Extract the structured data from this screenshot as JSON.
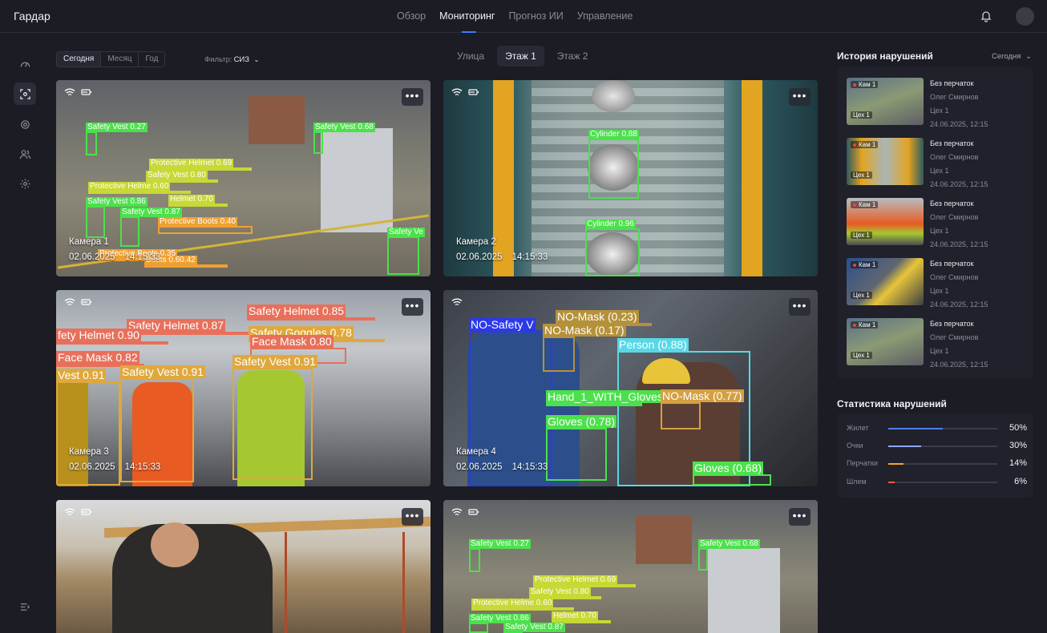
{
  "header": {
    "brand": "Гардар",
    "nav": [
      "Обзор",
      "Мониторинг",
      "Прогноз ИИ",
      "Управление"
    ],
    "active_nav": "Мониторинг"
  },
  "filters": {
    "periods": [
      "Сегодня",
      "Месяц",
      "Год"
    ],
    "active_period": "Сегодня",
    "filter_label": "Фильтр:",
    "filter_value": "СИЗ"
  },
  "floor_tabs": [
    "Улица",
    "Этаж 1",
    "Этаж 2"
  ],
  "active_floor": "Этаж 1",
  "cameras": [
    {
      "name": "Камера 1",
      "date": "02.06.2025",
      "time": "14:15:33",
      "detections": [
        {
          "label": "Safety Vest 0.27"
        },
        {
          "label": "Safety Vest 0.68"
        },
        {
          "label": "Protective Helmet 0.69"
        },
        {
          "label": "Safety Vest 0.80"
        },
        {
          "label": "Protective Helme 0.60"
        },
        {
          "label": "Safety Vest 0.86"
        },
        {
          "label": "Helmet 0.70"
        },
        {
          "label": "Safety Vest 0.87"
        },
        {
          "label": "Protective Boots 0.40"
        },
        {
          "label": "Protective Boots 0.35"
        },
        {
          "label": "Boots 0.60.42"
        },
        {
          "label": "Safety Ve"
        }
      ]
    },
    {
      "name": "Камера 2",
      "date": "02.06.2025",
      "time": "14:15:33",
      "detections": [
        {
          "label": "Cylinder 0.88"
        },
        {
          "label": "Cylinder 0.96"
        }
      ]
    },
    {
      "name": "Камера 3",
      "date": "02.06.2025",
      "time": "14:15:33",
      "detections": [
        {
          "label": "Safety Helmet 0.85"
        },
        {
          "label": "Safety Helmet 0.87"
        },
        {
          "label": "fety Helmet 0.90"
        },
        {
          "label": "Safety Goggles 0.78"
        },
        {
          "label": "Face Mask 0.80"
        },
        {
          "label": "Face Mask 0.82"
        },
        {
          "label": "Safety Vest 0.91"
        },
        {
          "label": "Vest 0.91"
        },
        {
          "label": "Safety Vest 0.91"
        }
      ]
    },
    {
      "name": "Камера 4",
      "date": "02.06.2025",
      "time": "14:15:33",
      "detections": [
        {
          "label": "NO-Safety V"
        },
        {
          "label": "NO-Mask (0.23)"
        },
        {
          "label": "NO-Mask (0.17)"
        },
        {
          "label": "Person (0.88)"
        },
        {
          "label": "Hand_1_WITH_Gloves"
        },
        {
          "label": "NO-Mask (0.77)"
        },
        {
          "label": "Gloves (0.78)"
        },
        {
          "label": "Gloves (0.68)"
        }
      ]
    },
    {
      "name": "",
      "date": "",
      "time": "",
      "detections": []
    },
    {
      "name": "",
      "date": "",
      "time": "",
      "detections": [
        {
          "label": "Safety Vest 0.27"
        },
        {
          "label": "Safety Vest 0.68"
        },
        {
          "label": "Protective Helmet 0.69"
        },
        {
          "label": "Safety Vest 0.80"
        },
        {
          "label": "Protective Helme 0.60"
        },
        {
          "label": "Safety Vest 0.86"
        },
        {
          "label": "Helmet 0.70"
        },
        {
          "label": "Safety Vest 0.87"
        }
      ]
    }
  ],
  "history": {
    "title": "История нарушений",
    "period": "Сегодня",
    "items": [
      {
        "cam": "Кам 1",
        "zone": "Цех 1",
        "type": "Без перчаток",
        "person": "Олег Смирнов",
        "area": "Цех 1",
        "datetime": "24.06.2025, 12:15"
      },
      {
        "cam": "Кам 1",
        "zone": "Цех 1",
        "type": "Без перчаток",
        "person": "Олег Смирнов",
        "area": "Цех 1",
        "datetime": "24.06.2025, 12:15"
      },
      {
        "cam": "Кам 1",
        "zone": "Цех 1",
        "type": "Без перчаток",
        "person": "Олег Смирнов",
        "area": "Цех 1",
        "datetime": "24.06.2025, 12:15"
      },
      {
        "cam": "Кам 1",
        "zone": "Цех 1",
        "type": "Без перчаток",
        "person": "Олег Смирнов",
        "area": "Цех 1",
        "datetime": "24.06.2025, 12:15"
      },
      {
        "cam": "Кам 1",
        "zone": "Цех 1",
        "type": "Без перчаток",
        "person": "Олег Смирнов",
        "area": "Цех 1",
        "datetime": "24.06.2025, 12:15"
      }
    ]
  },
  "stats": {
    "title": "Статистика нарушений",
    "rows": [
      {
        "label": "Жилет",
        "value": "50%",
        "fraction": 0.5,
        "color": "#4f7cff"
      },
      {
        "label": "Очки",
        "value": "30%",
        "fraction": 0.3,
        "color": "#8fa6ff"
      },
      {
        "label": "Перчатки",
        "value": "14%",
        "fraction": 0.14,
        "color": "#f5a524"
      },
      {
        "label": "Шлем",
        "value": "6%",
        "fraction": 0.06,
        "color": "#ff5a3c"
      }
    ]
  },
  "colors": {
    "accent": "#3d7bff",
    "background": "#1b1c24",
    "panel": "#20212a"
  },
  "icons": {
    "sidebar": [
      "gauge-icon",
      "camera-scan-icon",
      "chip-icon",
      "users-icon",
      "settings-icon"
    ],
    "collapse": "collapse-menu-icon"
  }
}
